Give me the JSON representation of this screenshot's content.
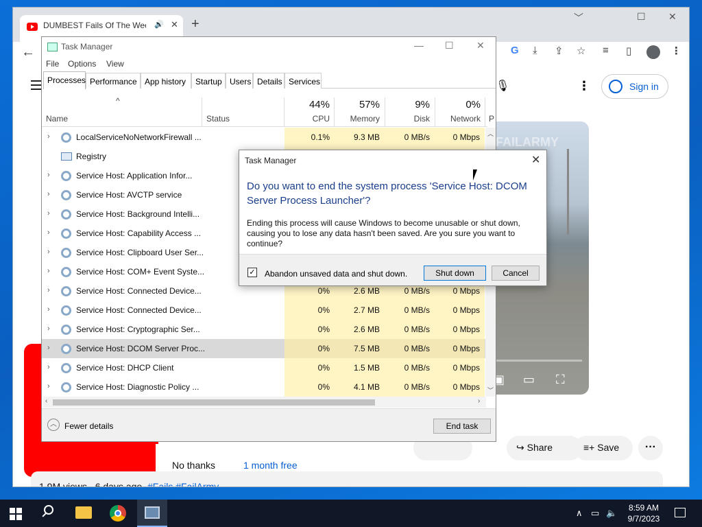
{
  "browser": {
    "tab_title": "DUMBEST Fails Of The Week",
    "audio_icon": "🔊",
    "close_icon": "✕",
    "new_tab": "+",
    "back": "←",
    "minimize": "﹀",
    "restore": "☐",
    "close": "✕",
    "toolbar_icons": [
      "G",
      "⤓",
      "⇪",
      "☆",
      "≡",
      "▯"
    ]
  },
  "youtube": {
    "sign_in": "Sign in",
    "mic_icon": "🎙",
    "kebab": "⋮",
    "watermark": "FAILARMY",
    "share": "Share",
    "save": "Save",
    "more": "···",
    "no_thanks": "No thanks",
    "month_free": "1 month free",
    "views": "1.9M views",
    "age": "6 days ago",
    "tags": "#Fails #FailArmy",
    "video_icons": [
      "▣",
      "▭",
      "⛶"
    ]
  },
  "task_manager": {
    "title": "Task Manager",
    "window_ctrls": [
      "—",
      "☐",
      "✕"
    ],
    "menu": [
      "File",
      "Options",
      "View"
    ],
    "tabs": [
      "Processes",
      "Performance",
      "App history",
      "Startup",
      "Users",
      "Details",
      "Services"
    ],
    "columns": {
      "name": "Name",
      "status": "Status",
      "cpu_pct": "44%",
      "cpu": "CPU",
      "memory_pct": "57%",
      "memory": "Memory",
      "disk_pct": "9%",
      "disk": "Disk",
      "network_pct": "0%",
      "network": "Network",
      "power_initial": "P"
    },
    "rows": [
      {
        "name": "LocalServiceNoNetworkFirewall ...",
        "cpu": "0.1%",
        "mem": "9.3 MB",
        "disk": "0 MB/s",
        "net": "0 Mbps"
      },
      {
        "name": "Registry",
        "cpu": "",
        "mem": "",
        "disk": "",
        "net": ""
      },
      {
        "name": "Service Host: Application Infor...",
        "cpu": "",
        "mem": "",
        "disk": "",
        "net": ""
      },
      {
        "name": "Service Host: AVCTP service",
        "cpu": "",
        "mem": "",
        "disk": "",
        "net": ""
      },
      {
        "name": "Service Host: Background Intelli...",
        "cpu": "",
        "mem": "",
        "disk": "",
        "net": ""
      },
      {
        "name": "Service Host: Capability Access ...",
        "cpu": "",
        "mem": "",
        "disk": "",
        "net": ""
      },
      {
        "name": "Service Host: Clipboard User Ser...",
        "cpu": "",
        "mem": "",
        "disk": "",
        "net": ""
      },
      {
        "name": "Service Host: COM+ Event Syste...",
        "cpu": "",
        "mem": "",
        "disk": "",
        "net": ""
      },
      {
        "name": "Service Host: Connected Device...",
        "cpu": "0%",
        "mem": "2.6 MB",
        "disk": "0 MB/s",
        "net": "0 Mbps"
      },
      {
        "name": "Service Host: Connected Device...",
        "cpu": "0%",
        "mem": "2.7 MB",
        "disk": "0 MB/s",
        "net": "0 Mbps"
      },
      {
        "name": "Service Host: Cryptographic Ser...",
        "cpu": "0%",
        "mem": "2.6 MB",
        "disk": "0 MB/s",
        "net": "0 Mbps"
      },
      {
        "name": "Service Host: DCOM Server Proc...",
        "cpu": "0%",
        "mem": "7.5 MB",
        "disk": "0 MB/s",
        "net": "0 Mbps"
      },
      {
        "name": "Service Host: DHCP Client",
        "cpu": "0%",
        "mem": "1.5 MB",
        "disk": "0 MB/s",
        "net": "0 Mbps"
      },
      {
        "name": "Service Host: Diagnostic Policy ...",
        "cpu": "0%",
        "mem": "4.1 MB",
        "disk": "0 MB/s",
        "net": "0 Mbps"
      }
    ],
    "selected_row": 11,
    "fewer_details": "Fewer details",
    "end_task": "End task"
  },
  "dialog": {
    "title": "Task Manager",
    "heading": "Do you want to end the system process 'Service Host: DCOM Server Process Launcher'?",
    "body": "Ending this process will cause Windows to become unusable or shut down, causing you to lose any data hasn't been saved. Are you sure you want to continue?",
    "checkbox_label": "Abandon unsaved data and shut down.",
    "checkbox_checked": true,
    "shut_down": "Shut down",
    "cancel": "Cancel",
    "close": "✕",
    "check_mark": "✓"
  },
  "taskbar": {
    "time": "8:59 AM",
    "date": "9/7/2023",
    "tray_icons": [
      "∧",
      "▭",
      "🔈"
    ]
  }
}
